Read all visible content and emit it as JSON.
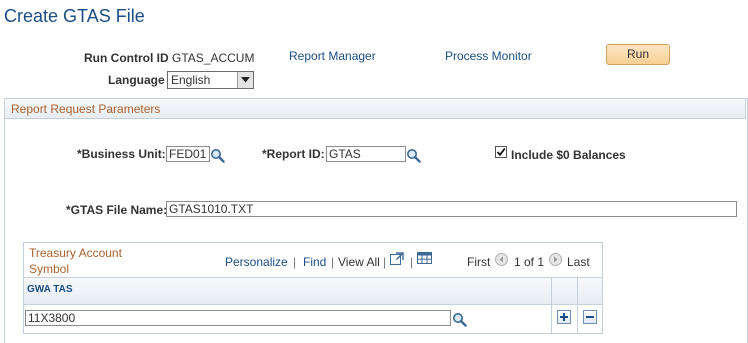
{
  "page": {
    "title": "Create GTAS File"
  },
  "header": {
    "run_control_label": "Run Control ID",
    "run_control_value": "GTAS_ACCUM",
    "report_manager": "Report Manager",
    "process_monitor": "Process Monitor",
    "run_button": "Run",
    "language_label": "Language",
    "language_value": "English"
  },
  "params": {
    "section_title": "Report Request Parameters",
    "business_unit_label": "*Business Unit:",
    "business_unit_value": "FED01",
    "report_id_label": "*Report ID:",
    "report_id_value": "GTAS",
    "include_zero_label": "Include $0 Balances",
    "include_zero_checked": true,
    "file_name_label": "*GTAS File Name:",
    "file_name_value": "GTAS1010.TXT"
  },
  "grid": {
    "title": "Treasury Account Symbol",
    "personalize": "Personalize",
    "find": "Find",
    "view_all": "View All",
    "first": "First",
    "page_info": "1 of 1",
    "last": "Last",
    "column_header": "GWA TAS",
    "rows": [
      {
        "gwa_tas": "11X3800"
      }
    ]
  },
  "icons": {
    "lookup": "magnifier-icon",
    "add_row": "plus-icon",
    "delete_row": "minus-icon",
    "zoom": "new-window-icon",
    "download": "spreadsheet-icon"
  },
  "colors": {
    "link": "#1b4e84",
    "section_title": "#a8622f",
    "run_button": "#f7cf93",
    "border": "#c6d0da"
  }
}
